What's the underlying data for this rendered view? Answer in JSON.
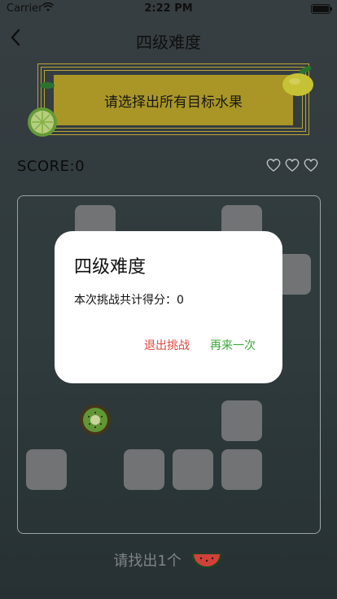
{
  "status_bar": {
    "carrier": "Carrier",
    "time": "2:22 PM"
  },
  "nav": {
    "title": "四级难度"
  },
  "banner": {
    "text": "请选择出所有目标水果"
  },
  "score": {
    "label": "SCORE:0"
  },
  "lives": {
    "hearts": 3
  },
  "hint": {
    "text": "请找出1个",
    "target_icon": "watermelon-icon"
  },
  "dialog": {
    "title": "四级难度",
    "message": "本次挑战共计得分：0",
    "exit_label": "退出挑战",
    "retry_label": "再来一次"
  },
  "colors": {
    "banner": "#b9a32a",
    "exit": "#e0453f",
    "retry": "#3aa83a",
    "tile": "#7b7d7e"
  }
}
